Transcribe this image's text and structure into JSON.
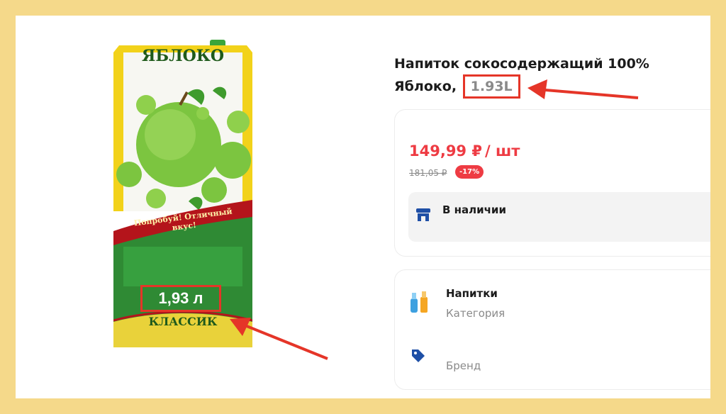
{
  "product": {
    "title_main": "Напиток сокосодержащий 100% Яблоко,",
    "title_volume": "1.93L",
    "package": {
      "brand": "ЯБЛОКО",
      "slogan": "Попробуй! Отличный вкус!",
      "volume": "1,93 л",
      "line": "КЛАССИК"
    }
  },
  "pricing": {
    "price": "149,99 ₽",
    "unit": "/ шт",
    "old_price": "181,05 ₽",
    "discount": "-17%"
  },
  "stock": {
    "label": "В наличии",
    "icon": "store-icon"
  },
  "info": {
    "category_value": "Напитки",
    "category_label": "Категория",
    "category_icon": "drinks-icon",
    "brand_label": "Бренд",
    "brand_icon": "tag-icon"
  },
  "colors": {
    "accent_red": "#ee3b43",
    "annotation_red": "#e53528",
    "frame_yellow": "#f5d98a",
    "icon_blue": "#1e4fa6"
  }
}
